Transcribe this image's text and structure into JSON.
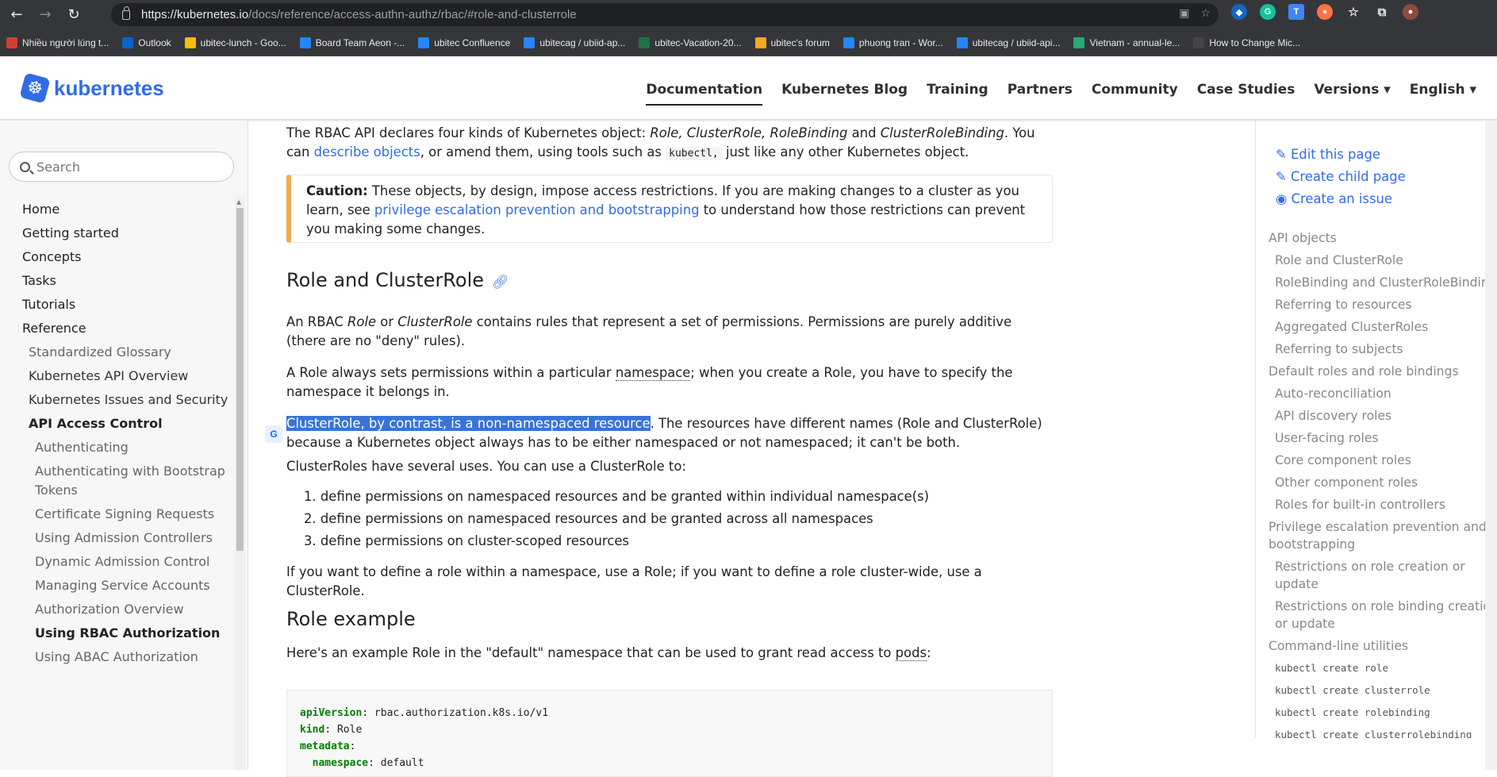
{
  "browser": {
    "url_host": "https://kubernetes.io",
    "url_path": "/docs/reference/access-authn-authz/rbac/#role-and-clusterrole",
    "bookmarks": [
      {
        "label": "Nhiều người lúng t...",
        "color": "#d23f31"
      },
      {
        "label": "Outlook",
        "color": "#0a64c9"
      },
      {
        "label": "ubitec-lunch - Goo...",
        "color": "#fbbc05"
      },
      {
        "label": "Board Team Aeon -...",
        "color": "#2684ff"
      },
      {
        "label": "ubitec Confluence",
        "color": "#2684ff"
      },
      {
        "label": "ubitecag / ubiid-ap...",
        "color": "#2684ff"
      },
      {
        "label": "ubitec-Vacation-20...",
        "color": "#1f7244"
      },
      {
        "label": "ubitec's forum",
        "color": "#f5a623"
      },
      {
        "label": "phuong tran - Wor...",
        "color": "#2684ff"
      },
      {
        "label": "ubitecag / ubiid-api...",
        "color": "#2684ff"
      },
      {
        "label": "Vietnam - annual-le...",
        "color": "#2aa876"
      },
      {
        "label": "How to Change Mic...",
        "color": "#444444"
      }
    ]
  },
  "site": {
    "logo_text": "kubernetes",
    "nav": [
      "Documentation",
      "Kubernetes Blog",
      "Training",
      "Partners",
      "Community",
      "Case Studies",
      "Versions",
      "English"
    ]
  },
  "sidebar": {
    "search_placeholder": "Search",
    "items": [
      {
        "label": "Home",
        "level": 1
      },
      {
        "label": "Getting started",
        "level": 1
      },
      {
        "label": "Concepts",
        "level": 1
      },
      {
        "label": "Tasks",
        "level": 1
      },
      {
        "label": "Tutorials",
        "level": 1
      },
      {
        "label": "Reference",
        "level": 1
      },
      {
        "label": "Standardized Glossary",
        "level": 2
      },
      {
        "label": "Kubernetes API Overview",
        "level": 2
      },
      {
        "label": "Kubernetes Issues and Security",
        "level": 2
      },
      {
        "label": "API Access Control",
        "level": 2
      },
      {
        "label": "Authenticating",
        "level": 3
      },
      {
        "label": "Authenticating with Bootstrap Tokens",
        "level": 3
      },
      {
        "label": "Certificate Signing Requests",
        "level": 3
      },
      {
        "label": "Using Admission Controllers",
        "level": 3
      },
      {
        "label": "Dynamic Admission Control",
        "level": 3
      },
      {
        "label": "Managing Service Accounts",
        "level": 3
      },
      {
        "label": "Authorization Overview",
        "level": 3
      },
      {
        "label": "Using RBAC Authorization",
        "level": 3
      },
      {
        "label": "Using ABAC Authorization",
        "level": 3
      }
    ]
  },
  "content": {
    "intro_1": "The RBAC API declares four kinds of Kubernetes object: ",
    "intro_objs": "Role, ClusterRole, RoleBinding",
    "intro_and": " and ",
    "intro_crb": "ClusterRoleBinding",
    "intro_2": ". You can ",
    "intro_link": "describe objects",
    "intro_3": ", or amend them, using tools such as ",
    "intro_code": "kubectl,",
    "intro_4": " just like any other Kubernetes object.",
    "caution_label": "Caution:",
    "caution_text": " These objects, by design, impose access restrictions. If you are making changes to a cluster as you learn, see ",
    "caution_link": "privilege escalation prevention and bootstrapping",
    "caution_text2": " to understand how those restrictions can prevent you making some changes.",
    "h_role": "Role and ClusterRole",
    "p1_a": "An RBAC ",
    "p1_role": "Role",
    "p1_or": " or ",
    "p1_crole": "ClusterRole",
    "p1_b": " contains rules that represent a set of permissions. Permissions are purely additive (there are no \"deny\" rules).",
    "p2_a": "A Role always sets permissions within a particular ",
    "p2_ns": "namespace",
    "p2_b": "; when you create a Role, you have to specify the namespace it belongs in.",
    "p3_hl": "ClusterRole, by contrast, is a non-namespaced resource",
    "p3_b": ". The resources have different names (Role and ClusterRole) because a Kubernetes object always has to be either namespaced or not namespaced; it can't be both.",
    "p4": "ClusterRoles have several uses. You can use a ClusterRole to:",
    "list": [
      "1. define permissions on namespaced resources and be granted within individual namespace(s)",
      "2. define permissions on namespaced resources and be granted across all namespaces",
      "3. define permissions on cluster-scoped resources"
    ],
    "p5": "If you want to define a role within a namespace, use a Role; if you want to define a role cluster-wide, use a ClusterRole.",
    "h_example": "Role example",
    "p6_a": "Here's an example Role in the \"default\" namespace that can be used to grant read access to ",
    "p6_pods": "pods",
    "p6_b": ":",
    "code": [
      {
        "k": "apiVersion",
        "v": " rbac.authorization.k8s.io/v1"
      },
      {
        "k": "kind",
        "v": " Role"
      },
      {
        "k": "metadata",
        "v": ""
      },
      {
        "k": "  namespace",
        "v": " default"
      }
    ]
  },
  "toc": {
    "actions": [
      "Edit this page",
      "Create child page",
      "Create an issue"
    ],
    "items": [
      {
        "label": "API objects",
        "level": 1
      },
      {
        "label": "Role and ClusterRole",
        "level": 2
      },
      {
        "label": "RoleBinding and ClusterRoleBinding",
        "level": 2
      },
      {
        "label": "Referring to resources",
        "level": 2
      },
      {
        "label": "Aggregated ClusterRoles",
        "level": 2
      },
      {
        "label": "Referring to subjects",
        "level": 2
      },
      {
        "label": "Default roles and role bindings",
        "level": 1
      },
      {
        "label": "Auto-reconciliation",
        "level": 2
      },
      {
        "label": "API discovery roles",
        "level": 2
      },
      {
        "label": "User-facing roles",
        "level": 2
      },
      {
        "label": "Core component roles",
        "level": 2
      },
      {
        "label": "Other component roles",
        "level": 2
      },
      {
        "label": "Roles for built-in controllers",
        "level": 2
      },
      {
        "label": "Privilege escalation prevention and bootstrapping",
        "level": 1
      },
      {
        "label": "Restrictions on role creation or update",
        "level": 2
      },
      {
        "label": "Restrictions on role binding creation or update",
        "level": 2
      },
      {
        "label": "Command-line utilities",
        "level": 1
      },
      {
        "label": "kubectl create role",
        "level": 3
      },
      {
        "label": "kubectl create clusterrole",
        "level": 3
      },
      {
        "label": "kubectl create rolebinding",
        "level": 3
      },
      {
        "label": "kubectl create clusterrolebinding",
        "level": 3
      }
    ]
  }
}
